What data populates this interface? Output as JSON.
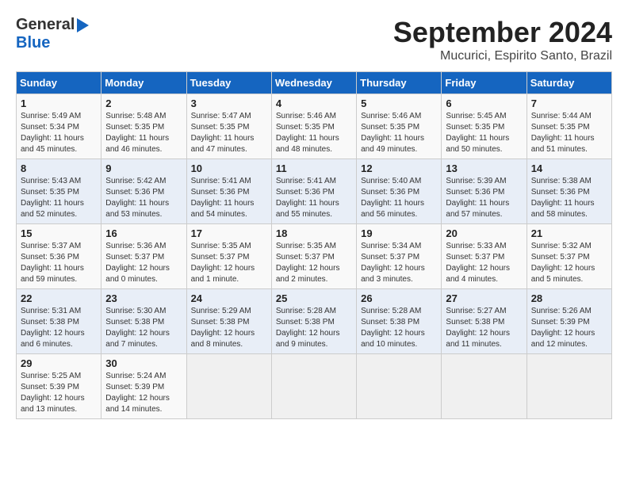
{
  "header": {
    "logo_line1": "General",
    "logo_line2": "Blue",
    "title": "September 2024",
    "subtitle": "Mucurici, Espirito Santo, Brazil"
  },
  "calendar": {
    "days_of_week": [
      "Sunday",
      "Monday",
      "Tuesday",
      "Wednesday",
      "Thursday",
      "Friday",
      "Saturday"
    ],
    "weeks": [
      [
        {
          "day": "",
          "info": ""
        },
        {
          "day": "2",
          "info": "Sunrise: 5:48 AM\nSunset: 5:35 PM\nDaylight: 11 hours\nand 46 minutes."
        },
        {
          "day": "3",
          "info": "Sunrise: 5:47 AM\nSunset: 5:35 PM\nDaylight: 11 hours\nand 47 minutes."
        },
        {
          "day": "4",
          "info": "Sunrise: 5:46 AM\nSunset: 5:35 PM\nDaylight: 11 hours\nand 48 minutes."
        },
        {
          "day": "5",
          "info": "Sunrise: 5:46 AM\nSunset: 5:35 PM\nDaylight: 11 hours\nand 49 minutes."
        },
        {
          "day": "6",
          "info": "Sunrise: 5:45 AM\nSunset: 5:35 PM\nDaylight: 11 hours\nand 50 minutes."
        },
        {
          "day": "7",
          "info": "Sunrise: 5:44 AM\nSunset: 5:35 PM\nDaylight: 11 hours\nand 51 minutes."
        }
      ],
      [
        {
          "day": "1",
          "info": "Sunrise: 5:49 AM\nSunset: 5:34 PM\nDaylight: 11 hours\nand 45 minutes."
        },
        {
          "day": "",
          "info": ""
        },
        {
          "day": "",
          "info": ""
        },
        {
          "day": "",
          "info": ""
        },
        {
          "day": "",
          "info": ""
        },
        {
          "day": "",
          "info": ""
        },
        {
          "day": "",
          "info": ""
        }
      ],
      [
        {
          "day": "8",
          "info": "Sunrise: 5:43 AM\nSunset: 5:35 PM\nDaylight: 11 hours\nand 52 minutes."
        },
        {
          "day": "9",
          "info": "Sunrise: 5:42 AM\nSunset: 5:36 PM\nDaylight: 11 hours\nand 53 minutes."
        },
        {
          "day": "10",
          "info": "Sunrise: 5:41 AM\nSunset: 5:36 PM\nDaylight: 11 hours\nand 54 minutes."
        },
        {
          "day": "11",
          "info": "Sunrise: 5:41 AM\nSunset: 5:36 PM\nDaylight: 11 hours\nand 55 minutes."
        },
        {
          "day": "12",
          "info": "Sunrise: 5:40 AM\nSunset: 5:36 PM\nDaylight: 11 hours\nand 56 minutes."
        },
        {
          "day": "13",
          "info": "Sunrise: 5:39 AM\nSunset: 5:36 PM\nDaylight: 11 hours\nand 57 minutes."
        },
        {
          "day": "14",
          "info": "Sunrise: 5:38 AM\nSunset: 5:36 PM\nDaylight: 11 hours\nand 58 minutes."
        }
      ],
      [
        {
          "day": "15",
          "info": "Sunrise: 5:37 AM\nSunset: 5:36 PM\nDaylight: 11 hours\nand 59 minutes."
        },
        {
          "day": "16",
          "info": "Sunrise: 5:36 AM\nSunset: 5:37 PM\nDaylight: 12 hours\nand 0 minutes."
        },
        {
          "day": "17",
          "info": "Sunrise: 5:35 AM\nSunset: 5:37 PM\nDaylight: 12 hours\nand 1 minute."
        },
        {
          "day": "18",
          "info": "Sunrise: 5:35 AM\nSunset: 5:37 PM\nDaylight: 12 hours\nand 2 minutes."
        },
        {
          "day": "19",
          "info": "Sunrise: 5:34 AM\nSunset: 5:37 PM\nDaylight: 12 hours\nand 3 minutes."
        },
        {
          "day": "20",
          "info": "Sunrise: 5:33 AM\nSunset: 5:37 PM\nDaylight: 12 hours\nand 4 minutes."
        },
        {
          "day": "21",
          "info": "Sunrise: 5:32 AM\nSunset: 5:37 PM\nDaylight: 12 hours\nand 5 minutes."
        }
      ],
      [
        {
          "day": "22",
          "info": "Sunrise: 5:31 AM\nSunset: 5:38 PM\nDaylight: 12 hours\nand 6 minutes."
        },
        {
          "day": "23",
          "info": "Sunrise: 5:30 AM\nSunset: 5:38 PM\nDaylight: 12 hours\nand 7 minutes."
        },
        {
          "day": "24",
          "info": "Sunrise: 5:29 AM\nSunset: 5:38 PM\nDaylight: 12 hours\nand 8 minutes."
        },
        {
          "day": "25",
          "info": "Sunrise: 5:28 AM\nSunset: 5:38 PM\nDaylight: 12 hours\nand 9 minutes."
        },
        {
          "day": "26",
          "info": "Sunrise: 5:28 AM\nSunset: 5:38 PM\nDaylight: 12 hours\nand 10 minutes."
        },
        {
          "day": "27",
          "info": "Sunrise: 5:27 AM\nSunset: 5:38 PM\nDaylight: 12 hours\nand 11 minutes."
        },
        {
          "day": "28",
          "info": "Sunrise: 5:26 AM\nSunset: 5:39 PM\nDaylight: 12 hours\nand 12 minutes."
        }
      ],
      [
        {
          "day": "29",
          "info": "Sunrise: 5:25 AM\nSunset: 5:39 PM\nDaylight: 12 hours\nand 13 minutes."
        },
        {
          "day": "30",
          "info": "Sunrise: 5:24 AM\nSunset: 5:39 PM\nDaylight: 12 hours\nand 14 minutes."
        },
        {
          "day": "",
          "info": ""
        },
        {
          "day": "",
          "info": ""
        },
        {
          "day": "",
          "info": ""
        },
        {
          "day": "",
          "info": ""
        },
        {
          "day": "",
          "info": ""
        }
      ]
    ]
  }
}
